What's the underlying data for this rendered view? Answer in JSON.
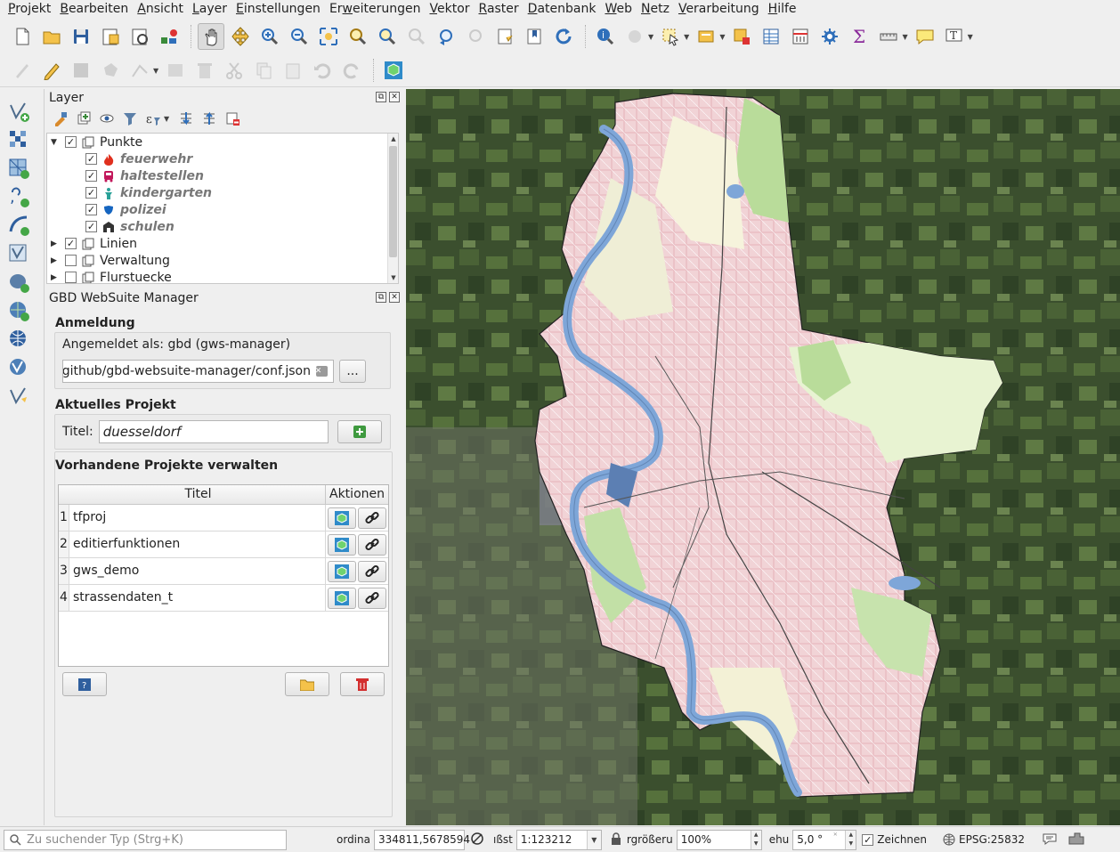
{
  "menubar": {
    "items": [
      {
        "label": "Projekt",
        "mn": "P"
      },
      {
        "label": "Bearbeiten",
        "mn": "B"
      },
      {
        "label": "Ansicht",
        "mn": "A"
      },
      {
        "label": "Layer",
        "mn": "L"
      },
      {
        "label": "Einstellungen",
        "mn": "E"
      },
      {
        "label": "Erweiterungen",
        "mn": "w"
      },
      {
        "label": "Vektor",
        "mn": "V"
      },
      {
        "label": "Raster",
        "mn": "R"
      },
      {
        "label": "Datenbank",
        "mn": "D"
      },
      {
        "label": "Web",
        "mn": "W"
      },
      {
        "label": "Netz",
        "mn": "N"
      },
      {
        "label": "Verarbeitung",
        "mn": "V"
      },
      {
        "label": "Hilfe",
        "mn": "H"
      }
    ]
  },
  "layer_panel": {
    "title": "Layer",
    "groups": [
      {
        "name": "Punkte",
        "checked": true,
        "expanded": true,
        "children": [
          {
            "name": "feuerwehr",
            "checked": true,
            "icon": "flame-icon",
            "color": "#e0301e"
          },
          {
            "name": "haltestellen",
            "checked": true,
            "icon": "bus-icon",
            "color": "#c2185b"
          },
          {
            "name": "kindergarten",
            "checked": true,
            "icon": "child-icon",
            "color": "#2aa198"
          },
          {
            "name": "polizei",
            "checked": true,
            "icon": "shield-icon",
            "color": "#1565c0"
          },
          {
            "name": "schulen",
            "checked": true,
            "icon": "school-icon",
            "color": "#333333"
          }
        ]
      },
      {
        "name": "Linien",
        "checked": true,
        "expanded": false
      },
      {
        "name": "Verwaltung",
        "checked": false,
        "expanded": false
      },
      {
        "name": "Flurstuecke",
        "checked": false,
        "expanded": false
      }
    ]
  },
  "gws_panel": {
    "title": "GBD WebSuite Manager",
    "login_header": "Anmeldung",
    "login_text": "Angemeldet als: gbd (gws-manager)",
    "config_path": "/github/gbd-websuite-manager/conf.json",
    "browse_label": "...",
    "current_header": "Aktuelles Projekt",
    "title_label": "Titel:",
    "title_value": "duesseldorf",
    "manage_header": "Vorhandene Projekte verwalten",
    "table": {
      "col_title": "Titel",
      "col_actions": "Aktionen",
      "rows": [
        {
          "num": "1",
          "name": "tfproj"
        },
        {
          "num": "2",
          "name": "editierfunktionen"
        },
        {
          "num": "3",
          "name": "gws_demo"
        },
        {
          "num": "4",
          "name": "strassendaten_t"
        }
      ]
    }
  },
  "statusbar": {
    "locator_placeholder": "Zu suchender Typ (Strg+K)",
    "coord_label": "ordina",
    "coord_value": "334811,5678594",
    "scale_label": "ıßst",
    "scale_value": "1:123212",
    "magnifier_label": "rgrößeru",
    "magnifier_value": "100%",
    "rotation_label": "ehu",
    "rotation_value": "5,0 °",
    "render_label": "Zeichnen",
    "render_checked": true,
    "crs": "EPSG:25832"
  },
  "colors": {
    "accent_blue": "#2f6fba",
    "river": "#7ea6d8",
    "urban": "#f1d3d6",
    "green": "#b9dc9a"
  }
}
